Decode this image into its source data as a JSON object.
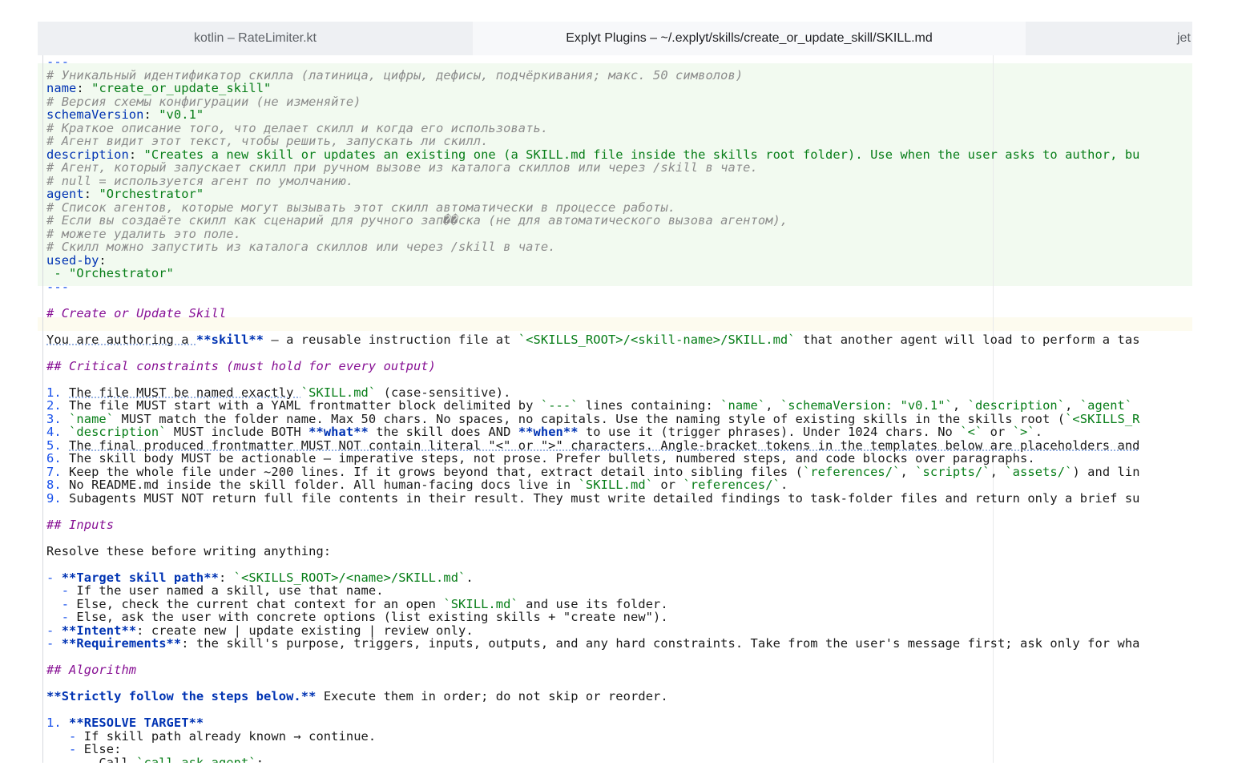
{
  "tabs": [
    {
      "label": "kotlin – RateLimiter.kt",
      "active": false
    },
    {
      "label": "Explyt Plugins – ~/.explyt/skills/create_or_update_skill/SKILL.md",
      "active": true
    },
    {
      "label": "jet",
      "active": false
    }
  ],
  "editor": {
    "lines": {
      "l0": "---",
      "l1": "# Уникальный идентификатор скилла (латиница, цифры, дефисы, подчёркивания; макс. 50 символов)",
      "l2k": "name",
      "l2v": "\"create_or_update_skill\"",
      "l3": "# Версия схемы конфигурации (не изменяйте)",
      "l4k": "schemaVersion",
      "l4v": "\"v0.1\"",
      "l5": "# Краткое описание того, что делает скилл и когда его использовать.",
      "l6": "# Агент видит этот текст, чтобы решить, запускать ли скилл.",
      "l7k": "description",
      "l7v": "\"Creates a new skill or updates an existing one (a SKILL.md file inside the skills root folder). Use when the user asks to author, bu",
      "l8": "# Агент, который запускает скилл при ручном вызове из каталога скиллов или через /skill в чате.",
      "l9": "# null = используется агент по умолчанию.",
      "l10k": "agent",
      "l10v": "\"Orchestrator\"",
      "l11": "# Список агентов, которые могут вызывать этот скилл автоматически в процессе работы.",
      "l12": "# Если вы создаёте скилл как сценарий для ручного зап��ска (не для автоматического вызова агентом),",
      "l13": "# можете удалить это поле.",
      "l14": "# Скилл можно запустить из каталога скиллов или через /skill в чате.",
      "l15k": "used-by",
      "l16": " - \"Orchestrator\"",
      "l17": "---",
      "l19": "# Create or Update Skill",
      "l21a": "You are authoring a ",
      "l21b": "**skill**",
      "l21c": " — a reusable instruction file at ",
      "l21d": "`<SKILLS_ROOT>/<skill-name>/SKILL.md`",
      "l21e": " that another agent will load to perform a tas",
      "l23": "## Critical constraints (must hold for every output)",
      "l25a": "1. ",
      "l25b": "The file MUST be named exactly ",
      "l25c": "`SKILL.md`",
      "l25d": " (case-sensitive).",
      "l26a": "2. ",
      "l26b": "The file MUST start with a YAML frontmatter block delimited by ",
      "l26c": "`---`",
      "l26d": " lines containing: ",
      "l26e": "`name`",
      "l26f": ", ",
      "l26g": "`schemaVersion: \"v0.1\"`",
      "l26h": ", ",
      "l26i": "`description`",
      "l26j": ", ",
      "l26k": "`agent`",
      "l27a": "3. ",
      "l27b": "`name`",
      "l27c": " MUST match the folder name. Max 50 chars. No spaces, no capitals. Use the naming style of existing skills in the skills root (",
      "l27d": "`<SKILLS_R",
      "l28a": "4. ",
      "l28b": "`description`",
      "l28c": " MUST include BOTH ",
      "l28d": "**what**",
      "l28e": " the skill does AND ",
      "l28f": "**when**",
      "l28g": " to use it (trigger phrases). Under 1024 chars. No ",
      "l28h": "`<`",
      "l28i": " or ",
      "l28j": "`>`",
      "l28k": ".",
      "l29a": "5. ",
      "l29b": "The final produced frontmatter MUST NOT contain literal \"<\" or \">\" characters. Angle-bracket tokens in the templates below are placeholders and",
      "l30a": "6. ",
      "l30b": "The skill body MUST be actionable — imperative steps, not prose. Prefer bullets, numbered steps, and code blocks over paragraphs.",
      "l31a": "7. ",
      "l31b": "Keep the whole file under ~200 lines. If it grows beyond that, extract detail into sibling files (",
      "l31c": "`references/`",
      "l31d": ", ",
      "l31e": "`scripts/`",
      "l31f": ", ",
      "l31g": "`assets/`",
      "l31h": ") and lin",
      "l32a": "8. ",
      "l32b": "No README.md inside the skill folder. All human-facing docs live in ",
      "l32c": "`SKILL.md`",
      "l32d": " or ",
      "l32e": "`references/`",
      "l32f": ".",
      "l33a": "9. ",
      "l33b": "Subagents MUST NOT return full file contents in their result. They must write detailed findings to task-folder files and return only a brief su",
      "l35": "## Inputs",
      "l37": "Resolve these before writing anything:",
      "l39a": "- ",
      "l39b": "**Target skill path**",
      "l39c": ": ",
      "l39d": "`<SKILLS_ROOT>/<name>/SKILL.md`",
      "l39e": ".",
      "l40a": "  - ",
      "l40b": "If the user named a skill, use that name.",
      "l41a": "  - ",
      "l41b": "Else, check the current chat context for an open ",
      "l41c": "`SKILL.md`",
      "l41d": " and use its folder.",
      "l42a": "  - ",
      "l42b": "Else, ask the user with concrete options (list existing skills + \"create new\").",
      "l43a": "- ",
      "l43b": "**Intent**",
      "l43c": ": create new | update existing | review only.",
      "l44a": "- ",
      "l44b": "**Requirements**",
      "l44c": ": the skill's purpose, triggers, inputs, outputs, and any hard constraints. Take from the user's message first; ask only for wha",
      "l46": "## Algorithm",
      "l48a": "**Strictly follow the steps below.**",
      "l48b": " Execute them in order; do not skip or reorder.",
      "l50a": "1. ",
      "l50b": "**RESOLVE TARGET**",
      "l51a": "   - ",
      "l51b": "If skill path already known → continue.",
      "l52a": "   - ",
      "l52b": "Else:",
      "l53a": "     - ",
      "l53b": "Call ",
      "l53c": "`call_ask_agent`",
      "l53d": ":"
    }
  },
  "colors": {
    "comment": "#8c8c8c",
    "key": "#0033b3",
    "string": "#067d17",
    "heading": "#871094",
    "frontmatter_bg": "#f2faf0",
    "caret_line_bg": "#fdfbef"
  }
}
